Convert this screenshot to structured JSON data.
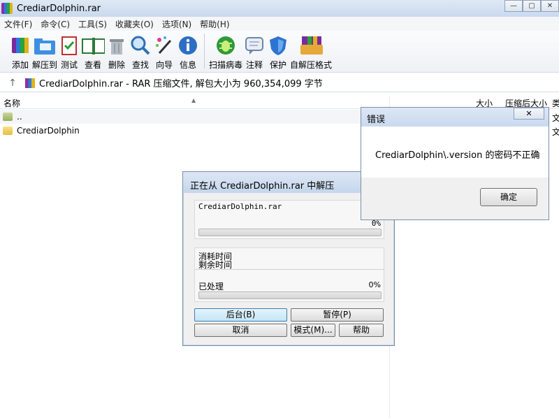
{
  "window": {
    "title": "CrediarDolphin.rar",
    "controls": [
      "—",
      "▢",
      "✕"
    ]
  },
  "menu": [
    "文件(F)",
    "命令(C)",
    "工具(S)",
    "收藏夹(O)",
    "选项(N)",
    "帮助(H)"
  ],
  "toolbar": [
    {
      "label": "添加",
      "icon": "add-archive-icon"
    },
    {
      "label": "解压到",
      "icon": "extract-to-icon"
    },
    {
      "label": "测试",
      "icon": "test-icon"
    },
    {
      "label": "查看",
      "icon": "view-icon"
    },
    {
      "label": "删除",
      "icon": "delete-icon"
    },
    {
      "label": "查找",
      "icon": "find-icon"
    },
    {
      "label": "向导",
      "icon": "wizard-icon"
    },
    {
      "label": "信息",
      "icon": "info-icon"
    },
    {
      "label": "扫描病毒",
      "icon": "virus-scan-icon"
    },
    {
      "label": "注释",
      "icon": "comment-icon"
    },
    {
      "label": "保护",
      "icon": "protect-icon"
    },
    {
      "label": "自解压格式",
      "icon": "sfx-icon"
    }
  ],
  "address": "CrediarDolphin.rar - RAR 压缩文件, 解包大小为 960,354,099 字节",
  "columns": {
    "name": "名称",
    "size": "大小",
    "packed": "压缩后大小",
    "type": "类"
  },
  "rows": [
    {
      "name": "..",
      "type": "文"
    },
    {
      "name": "CrediarDolphin",
      "type": "文"
    }
  ],
  "progress": {
    "title": "正在从 CrediarDolphin.rar 中解压",
    "file": "CrediarDolphin.rar",
    "file_percent": "0%",
    "elapsed_label": "消耗时间",
    "remaining_label": "剩余时间",
    "processed_label": "已处理",
    "processed_percent": "0%",
    "buttons": {
      "background": "后台(B)",
      "pause": "暂停(P)",
      "cancel": "取消",
      "mode": "模式(M)...",
      "help": "帮助"
    }
  },
  "error": {
    "title": "错误",
    "close": "✕",
    "message": "CrediarDolphin\\.version 的密码不正确",
    "ok": "确定"
  }
}
